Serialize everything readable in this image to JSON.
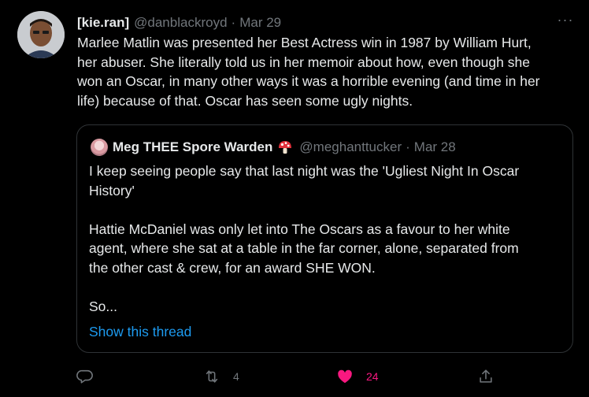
{
  "tweet": {
    "display_name": "[kie.ran]",
    "handle": "@danblackroyd",
    "separator": "·",
    "time": "Mar 29",
    "more": "···",
    "lines": [
      "Marlee Matlin was presented her Best Actress win in 1987 by William Hurt,",
      "her abuser. She literally told us in her memoir about how, even though she",
      "won an Oscar, in many other ways it was a horrible evening (and time in her",
      "life) because of that. Oscar has seen some ugly nights."
    ]
  },
  "quote": {
    "display_name": "Meg THEE Spore Warden",
    "handle": "@meghanttucker",
    "separator": "·",
    "time": "Mar 28",
    "lines": [
      "I keep seeing people say that last night was the 'Ugliest Night In Oscar",
      "History'",
      "",
      "Hattie McDaniel was only let into The Oscars as a favour to her white",
      "agent, where she sat at a table in the far corner, alone, separated from",
      "the other cast & crew, for an award SHE WON.",
      "",
      "So..."
    ],
    "show_thread": "Show this thread"
  },
  "actions": {
    "retweet_count": "4",
    "like_count": "24",
    "reply_icon": "reply-icon",
    "retweet_icon": "retweet-icon",
    "like_icon": "heart-icon",
    "share_icon": "share-icon"
  },
  "colors": {
    "background": "#000000",
    "text": "#e7e9ea",
    "muted": "#71767b",
    "link": "#1d9bf0",
    "like": "#f91880",
    "border": "#2f3336"
  }
}
